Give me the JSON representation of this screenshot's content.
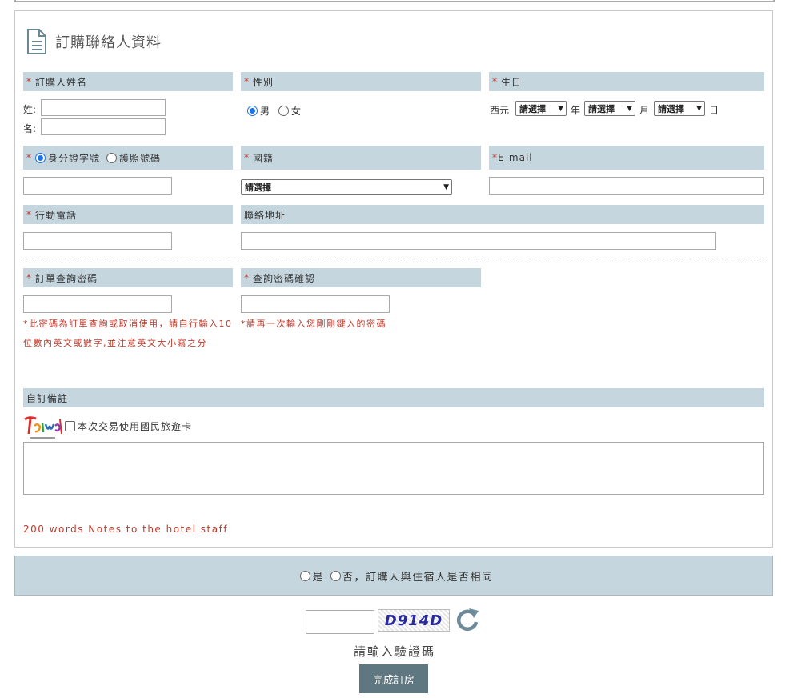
{
  "section": {
    "title": "訂購聯絡人資料"
  },
  "name": {
    "header": "訂購人姓名",
    "surname_label": "姓:",
    "given_label": "名:"
  },
  "gender": {
    "header": "性別",
    "male": "男",
    "female": "女",
    "selected": "male"
  },
  "birthday": {
    "header": "生日",
    "era": "西元",
    "select_placeholder": "請選擇",
    "year_unit": "年",
    "month_unit": "月",
    "day_unit": "日"
  },
  "id_type": {
    "option_id": "身分證字號",
    "option_passport": "護照號碼",
    "selected": "id"
  },
  "nationality": {
    "header": "國籍",
    "select_placeholder": "請選擇"
  },
  "email": {
    "header": "E-mail"
  },
  "mobile": {
    "header": "行動電話"
  },
  "address": {
    "header": "聯絡地址"
  },
  "password": {
    "header": "訂單查詢密碼",
    "note": "*此密碼為訂單查詢或取消使用，請自行輸入10位數內英文或數字,並注意英文大小寫之分"
  },
  "password_confirm": {
    "header": "查詢密碼確認",
    "note": "*請再一次輸入您剛剛鍵入的密碼"
  },
  "remarks": {
    "header": "自訂備註",
    "travel_card_label": "本次交易使用國民旅遊卡",
    "note": "200 words Notes to the hotel staff"
  },
  "same_guest": {
    "yes": "是",
    "no": "否",
    "question": "，訂購人與住宿人是否相同"
  },
  "captcha": {
    "code": "D914D",
    "label": "請輸入驗證碼"
  },
  "submit": {
    "label": "完成訂房"
  },
  "colors": {
    "header_bg": "#c5d6df",
    "required": "#c0392b",
    "submit_bg": "#5f7780",
    "radio_selected": "#1a73e8"
  }
}
